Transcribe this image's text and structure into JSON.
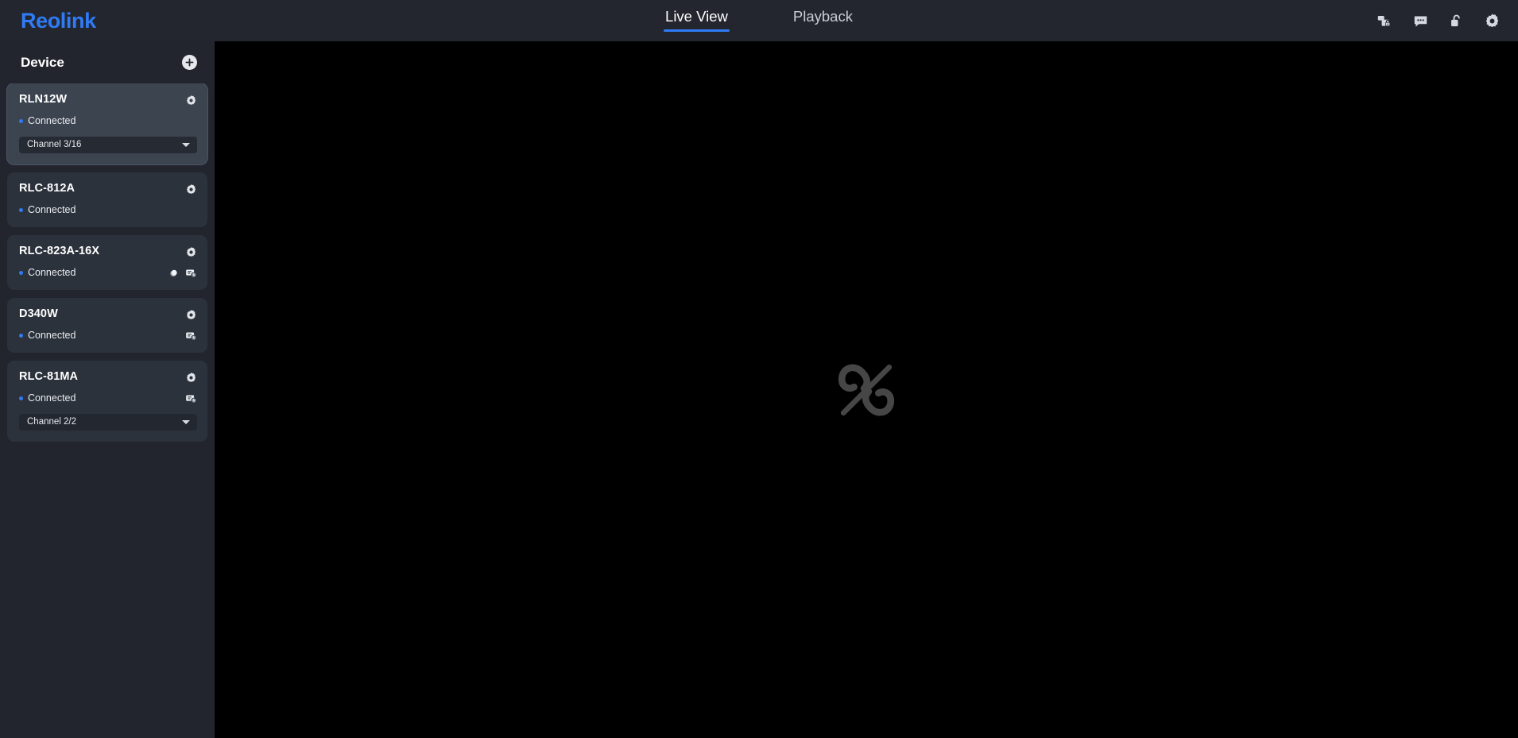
{
  "app": {
    "brand": "Reolink",
    "accent_color": "#2f7bf6",
    "topbar_bg": "#23262f",
    "sidebar_bg": "#22252e",
    "card_bg": "#2c323c",
    "card_selected_bg": "#3c4450",
    "stage_bg": "#000000"
  },
  "nav": {
    "tabs": [
      {
        "label": "Live View",
        "active": true
      },
      {
        "label": "Playback",
        "active": false
      }
    ]
  },
  "topbar_icons": [
    {
      "name": "devices-lock-icon",
      "title": "Devices"
    },
    {
      "name": "chat-bubble-icon",
      "title": "Messages"
    },
    {
      "name": "unlock-padlock-icon",
      "title": "Lock"
    },
    {
      "name": "gear-icon",
      "title": "Settings"
    }
  ],
  "sidebar": {
    "title": "Device",
    "add_button": {
      "name": "add-device-button",
      "glyph": "+"
    },
    "devices": [
      {
        "name": "RLN12W",
        "status": "Connected",
        "selected": true,
        "badges": [],
        "channel": "Channel 3/16",
        "has_channel": true
      },
      {
        "name": "RLC-812A",
        "status": "Connected",
        "selected": false,
        "badges": [],
        "channel": "",
        "has_channel": false
      },
      {
        "name": "RLC-823A-16X",
        "status": "Connected",
        "selected": false,
        "badges": [
          "spotlight-icon",
          "sd-card-warning-icon"
        ],
        "channel": "",
        "has_channel": false
      },
      {
        "name": "D340W",
        "status": "Connected",
        "selected": false,
        "badges": [
          "sd-card-warning-icon"
        ],
        "channel": "",
        "has_channel": false
      },
      {
        "name": "RLC-81MA",
        "status": "Connected",
        "selected": false,
        "badges": [
          "sd-card-warning-icon"
        ],
        "channel": "Channel 2/2",
        "has_channel": true
      }
    ]
  },
  "stage": {
    "placeholder_icon": "broken-link-icon"
  }
}
